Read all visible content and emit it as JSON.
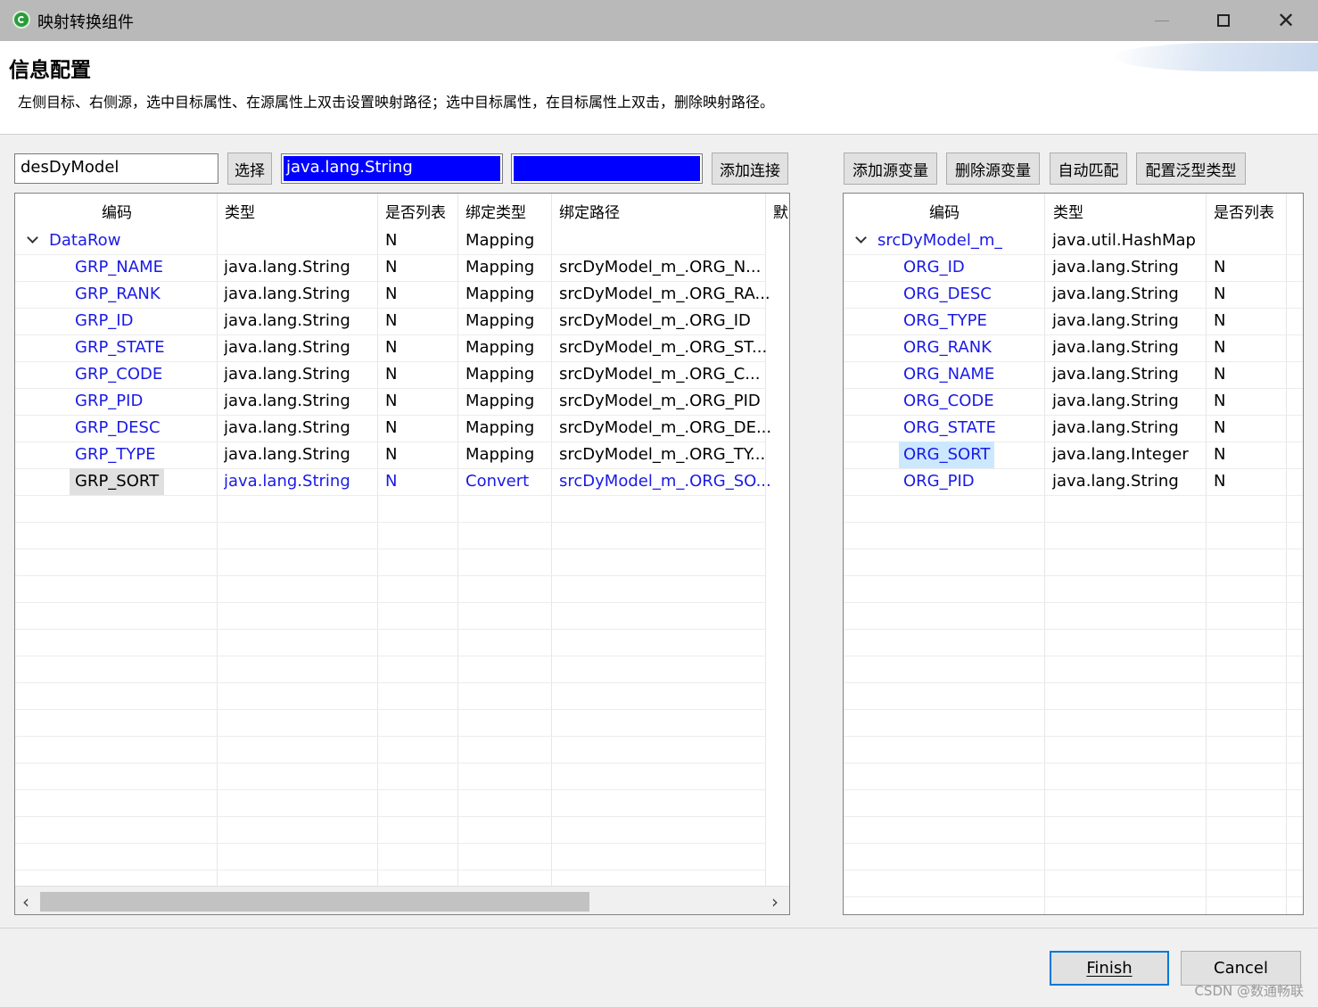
{
  "window": {
    "title": "映射转换组件"
  },
  "header": {
    "title": "信息配置",
    "description": "左侧目标、右侧源，选中目标属性、在源属性上双击设置映射路径；选中目标属性，在目标属性上双击，删除映射路径。"
  },
  "toolbar": {
    "model_value": "desDyModel",
    "select_label": "选择",
    "type_value": "java.lang.String",
    "blank_value": "",
    "add_link_label": "添加连接",
    "add_source_var_label": "添加源变量",
    "del_source_var_label": "删除源变量",
    "auto_match_label": "自动匹配",
    "generic_type_label": "配置泛型类型"
  },
  "target_table": {
    "columns": [
      "编码",
      "类型",
      "是否列表",
      "绑定类型",
      "绑定路径",
      "默"
    ],
    "root": {
      "code": "DataRow",
      "type": "",
      "is_list": "N",
      "bind_type": "Mapping",
      "bind_path": ""
    },
    "rows": [
      {
        "code": "GRP_NAME",
        "type": "java.lang.String",
        "is_list": "N",
        "bind_type": "Mapping",
        "bind_path": "srcDyModel_m_.ORG_N..."
      },
      {
        "code": "GRP_RANK",
        "type": "java.lang.String",
        "is_list": "N",
        "bind_type": "Mapping",
        "bind_path": "srcDyModel_m_.ORG_RA..."
      },
      {
        "code": "GRP_ID",
        "type": "java.lang.String",
        "is_list": "N",
        "bind_type": "Mapping",
        "bind_path": "srcDyModel_m_.ORG_ID"
      },
      {
        "code": "GRP_STATE",
        "type": "java.lang.String",
        "is_list": "N",
        "bind_type": "Mapping",
        "bind_path": "srcDyModel_m_.ORG_ST..."
      },
      {
        "code": "GRP_CODE",
        "type": "java.lang.String",
        "is_list": "N",
        "bind_type": "Mapping",
        "bind_path": "srcDyModel_m_.ORG_C..."
      },
      {
        "code": "GRP_PID",
        "type": "java.lang.String",
        "is_list": "N",
        "bind_type": "Mapping",
        "bind_path": "srcDyModel_m_.ORG_PID"
      },
      {
        "code": "GRP_DESC",
        "type": "java.lang.String",
        "is_list": "N",
        "bind_type": "Mapping",
        "bind_path": "srcDyModel_m_.ORG_DE..."
      },
      {
        "code": "GRP_TYPE",
        "type": "java.lang.String",
        "is_list": "N",
        "bind_type": "Mapping",
        "bind_path": "srcDyModel_m_.ORG_TY..."
      },
      {
        "code": "GRP_SORT",
        "type": "java.lang.String",
        "is_list": "N",
        "bind_type": "Convert",
        "bind_path": "srcDyModel_m_.ORG_SO...",
        "selected": true
      }
    ]
  },
  "source_table": {
    "columns": [
      "编码",
      "类型",
      "是否列表"
    ],
    "root": {
      "code": "srcDyModel_m_",
      "type": "java.util.HashMap",
      "is_list": ""
    },
    "rows": [
      {
        "code": "ORG_ID",
        "type": "java.lang.String",
        "is_list": "N"
      },
      {
        "code": "ORG_DESC",
        "type": "java.lang.String",
        "is_list": "N"
      },
      {
        "code": "ORG_TYPE",
        "type": "java.lang.String",
        "is_list": "N"
      },
      {
        "code": "ORG_RANK",
        "type": "java.lang.String",
        "is_list": "N"
      },
      {
        "code": "ORG_NAME",
        "type": "java.lang.String",
        "is_list": "N"
      },
      {
        "code": "ORG_CODE",
        "type": "java.lang.String",
        "is_list": "N"
      },
      {
        "code": "ORG_STATE",
        "type": "java.lang.String",
        "is_list": "N"
      },
      {
        "code": "ORG_SORT",
        "type": "java.lang.Integer",
        "is_list": "N",
        "selected": true
      },
      {
        "code": "ORG_PID",
        "type": "java.lang.String",
        "is_list": "N"
      }
    ]
  },
  "footer": {
    "finish_label": "Finish",
    "cancel_label": "Cancel",
    "watermark": "CSDN @数通畅联"
  },
  "colors": {
    "link_blue": "#1a1ae6",
    "field_blue": "#0000ff",
    "selected_source_bg": "#cce8ff",
    "selected_target_bg": "#e0e0e0",
    "focus_border": "#0078d7"
  }
}
